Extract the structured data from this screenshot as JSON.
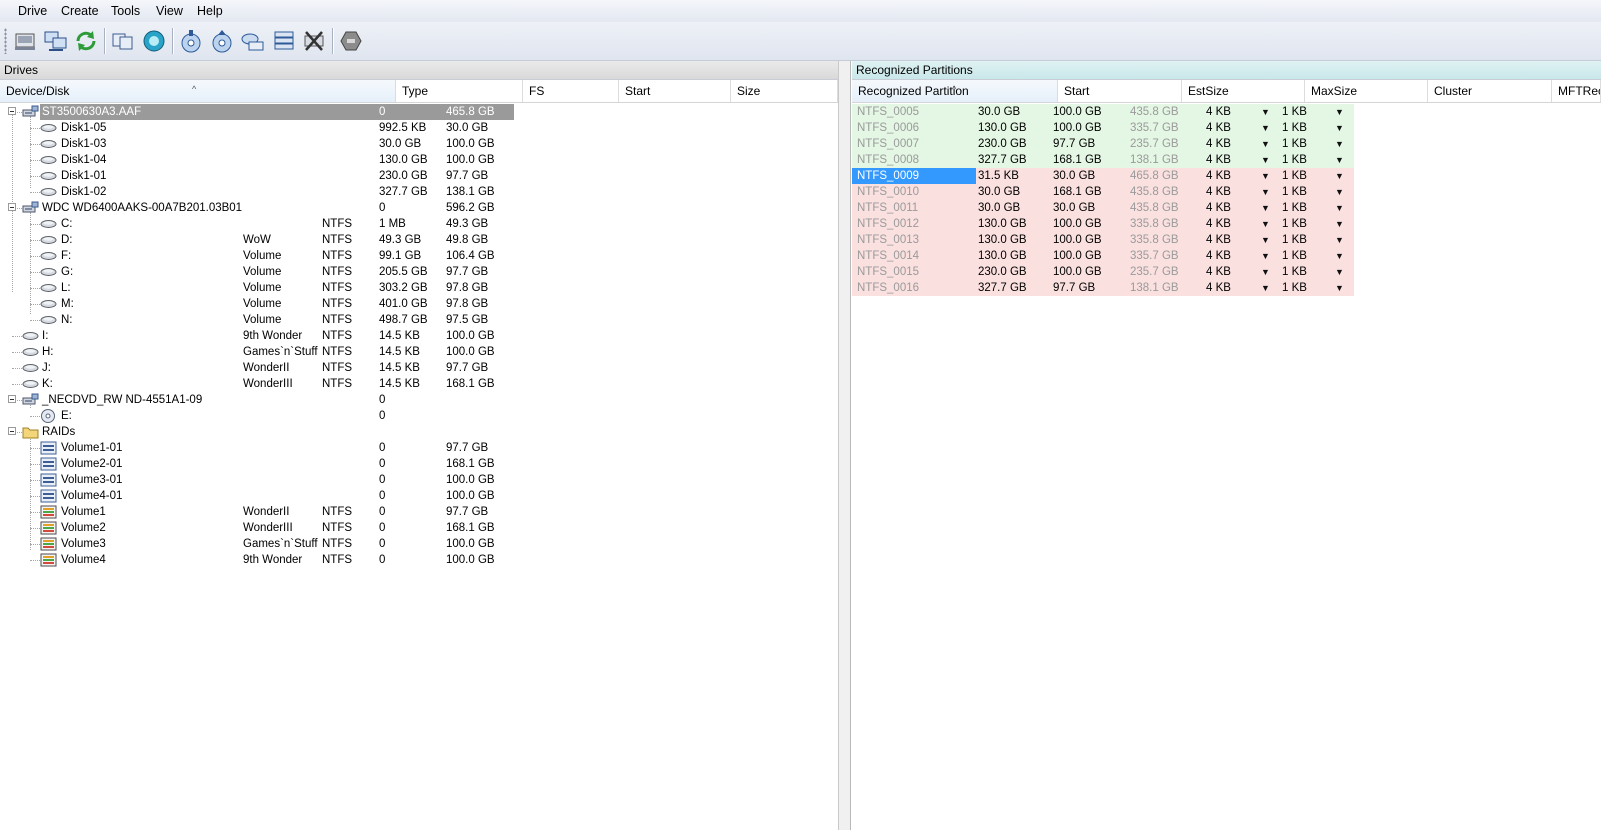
{
  "menu": [
    "Drive",
    "Create",
    "Tools",
    "View",
    "Help"
  ],
  "toolbar_icons": [
    "drive-icon",
    "network-drive-icon",
    "refresh-icon",
    "copy-icon",
    "scan-icon",
    "disk-image-icon",
    "open-image-icon",
    "virtual-drive-icon",
    "raid-icon",
    "remove-icon",
    "hex-editor-icon"
  ],
  "drives": {
    "title": "Drives",
    "columns": [
      "Device/Disk",
      "Type",
      "FS",
      "Start",
      "Size"
    ],
    "rows": [
      {
        "name": "ST3500630A3.AAF",
        "type": "",
        "fs": "",
        "start": "0",
        "size": "465.8 GB",
        "level": 0,
        "icon": "hard-disk-icon",
        "expander": true,
        "selected": true
      },
      {
        "name": "Disk1-05",
        "type": "",
        "fs": "",
        "start": "992.5 KB",
        "size": "30.0 GB",
        "level": 1,
        "icon": "partition-icon"
      },
      {
        "name": "Disk1-03",
        "type": "",
        "fs": "",
        "start": "30.0 GB",
        "size": "100.0 GB",
        "level": 1,
        "icon": "partition-icon"
      },
      {
        "name": "Disk1-04",
        "type": "",
        "fs": "",
        "start": "130.0 GB",
        "size": "100.0 GB",
        "level": 1,
        "icon": "partition-icon"
      },
      {
        "name": "Disk1-01",
        "type": "",
        "fs": "",
        "start": "230.0 GB",
        "size": "97.7 GB",
        "level": 1,
        "icon": "partition-icon"
      },
      {
        "name": "Disk1-02",
        "type": "",
        "fs": "",
        "start": "327.7 GB",
        "size": "138.1 GB",
        "level": 1,
        "icon": "partition-icon"
      },
      {
        "name": "WDC WD6400AAKS-00A7B201.03B01",
        "type": "",
        "fs": "",
        "start": "0",
        "size": "596.2 GB",
        "level": 0,
        "icon": "hard-disk-icon",
        "expander": true
      },
      {
        "name": "C:",
        "type": "",
        "fs": "NTFS",
        "start": "1 MB",
        "size": "49.3 GB",
        "level": 1,
        "icon": "partition-icon"
      },
      {
        "name": "D:",
        "type": "WoW",
        "fs": "NTFS",
        "start": "49.3 GB",
        "size": "49.8 GB",
        "level": 1,
        "icon": "partition-icon"
      },
      {
        "name": "F:",
        "type": "Volume",
        "fs": "NTFS",
        "start": "99.1 GB",
        "size": "106.4 GB",
        "level": 1,
        "icon": "partition-icon"
      },
      {
        "name": "G:",
        "type": "Volume",
        "fs": "NTFS",
        "start": "205.5 GB",
        "size": "97.7 GB",
        "level": 1,
        "icon": "partition-icon"
      },
      {
        "name": "L:",
        "type": "Volume",
        "fs": "NTFS",
        "start": "303.2 GB",
        "size": "97.8 GB",
        "level": 1,
        "icon": "partition-icon"
      },
      {
        "name": "M:",
        "type": "Volume",
        "fs": "NTFS",
        "start": "401.0 GB",
        "size": "97.8 GB",
        "level": 1,
        "icon": "partition-icon"
      },
      {
        "name": "N:",
        "type": "Volume",
        "fs": "NTFS",
        "start": "498.7 GB",
        "size": "97.5 GB",
        "level": 1,
        "icon": "partition-icon"
      },
      {
        "name": "I:",
        "type": "9th Wonder",
        "fs": "NTFS",
        "start": "14.5 KB",
        "size": "100.0 GB",
        "level": 0,
        "icon": "partition-icon"
      },
      {
        "name": "H:",
        "type": "Games`n`Stuff",
        "fs": "NTFS",
        "start": "14.5 KB",
        "size": "100.0 GB",
        "level": 0,
        "icon": "partition-icon"
      },
      {
        "name": "J:",
        "type": "WonderII",
        "fs": "NTFS",
        "start": "14.5 KB",
        "size": "97.7 GB",
        "level": 0,
        "icon": "partition-icon"
      },
      {
        "name": "K:",
        "type": "WonderIII",
        "fs": "NTFS",
        "start": "14.5 KB",
        "size": "168.1 GB",
        "level": 0,
        "icon": "partition-icon"
      },
      {
        "name": "_NECDVD_RW ND-4551A1-09",
        "type": "",
        "fs": "",
        "start": "0",
        "size": "",
        "level": 0,
        "icon": "hard-disk-icon",
        "expander": true
      },
      {
        "name": "E:",
        "type": "",
        "fs": "",
        "start": "0",
        "size": "",
        "level": 1,
        "icon": "cd-drive-icon"
      },
      {
        "name": "RAIDs",
        "type": "",
        "fs": "",
        "start": "",
        "size": "",
        "level": 0,
        "icon": "folder-icon",
        "expander": true
      },
      {
        "name": "Volume1-01",
        "type": "",
        "fs": "",
        "start": "0",
        "size": "97.7 GB",
        "level": 1,
        "icon": "raid-volume-icon"
      },
      {
        "name": "Volume2-01",
        "type": "",
        "fs": "",
        "start": "0",
        "size": "168.1 GB",
        "level": 1,
        "icon": "raid-volume-icon"
      },
      {
        "name": "Volume3-01",
        "type": "",
        "fs": "",
        "start": "0",
        "size": "100.0 GB",
        "level": 1,
        "icon": "raid-volume-icon"
      },
      {
        "name": "Volume4-01",
        "type": "",
        "fs": "",
        "start": "0",
        "size": "100.0 GB",
        "level": 1,
        "icon": "raid-volume-icon"
      },
      {
        "name": "Volume1",
        "type": "WonderII",
        "fs": "NTFS",
        "start": "0",
        "size": "97.7 GB",
        "level": 1,
        "icon": "raid-array-icon"
      },
      {
        "name": "Volume2",
        "type": "WonderIII",
        "fs": "NTFS",
        "start": "0",
        "size": "168.1 GB",
        "level": 1,
        "icon": "raid-array-icon"
      },
      {
        "name": "Volume3",
        "type": "Games`n`Stuff",
        "fs": "NTFS",
        "start": "0",
        "size": "100.0 GB",
        "level": 1,
        "icon": "raid-array-icon"
      },
      {
        "name": "Volume4",
        "type": "9th Wonder",
        "fs": "NTFS",
        "start": "0",
        "size": "100.0 GB",
        "level": 1,
        "icon": "raid-array-icon"
      }
    ]
  },
  "partitions": {
    "title": "Recognized Partitions",
    "columns": [
      "Recognized Partition",
      "Start",
      "EstSize",
      "MaxSize",
      "Cluster",
      "MFTRec"
    ],
    "rows": [
      {
        "name": "NTFS_0005",
        "start": "30.0 GB",
        "est": "100.0 GB",
        "max": "435.8 GB",
        "cluster": "4 KB",
        "mft": "1 KB",
        "status": "good"
      },
      {
        "name": "NTFS_0006",
        "start": "130.0 GB",
        "est": "100.0 GB",
        "max": "335.7 GB",
        "cluster": "4 KB",
        "mft": "1 KB",
        "status": "good"
      },
      {
        "name": "NTFS_0007",
        "start": "230.0 GB",
        "est": "97.7 GB",
        "max": "235.7 GB",
        "cluster": "4 KB",
        "mft": "1 KB",
        "status": "good"
      },
      {
        "name": "NTFS_0008",
        "start": "327.7 GB",
        "est": "168.1 GB",
        "max": "138.1 GB",
        "cluster": "4 KB",
        "mft": "1 KB",
        "status": "good"
      },
      {
        "name": "NTFS_0009",
        "start": "31.5 KB",
        "est": "30.0 GB",
        "max": "465.8 GB",
        "cluster": "4 KB",
        "mft": "1 KB",
        "status": "bad",
        "active": true
      },
      {
        "name": "NTFS_0010",
        "start": "30.0 GB",
        "est": "168.1 GB",
        "max": "435.8 GB",
        "cluster": "4 KB",
        "mft": "1 KB",
        "status": "bad"
      },
      {
        "name": "NTFS_0011",
        "start": "30.0 GB",
        "est": "30.0 GB",
        "max": "435.8 GB",
        "cluster": "4 KB",
        "mft": "1 KB",
        "status": "bad"
      },
      {
        "name": "NTFS_0012",
        "start": "130.0 GB",
        "est": "100.0 GB",
        "max": "335.8 GB",
        "cluster": "4 KB",
        "mft": "1 KB",
        "status": "bad"
      },
      {
        "name": "NTFS_0013",
        "start": "130.0 GB",
        "est": "100.0 GB",
        "max": "335.8 GB",
        "cluster": "4 KB",
        "mft": "1 KB",
        "status": "bad"
      },
      {
        "name": "NTFS_0014",
        "start": "130.0 GB",
        "est": "100.0 GB",
        "max": "335.7 GB",
        "cluster": "4 KB",
        "mft": "1 KB",
        "status": "bad"
      },
      {
        "name": "NTFS_0015",
        "start": "230.0 GB",
        "est": "100.0 GB",
        "max": "235.7 GB",
        "cluster": "4 KB",
        "mft": "1 KB",
        "status": "bad"
      },
      {
        "name": "NTFS_0016",
        "start": "327.7 GB",
        "est": "97.7 GB",
        "max": "138.1 GB",
        "cluster": "4 KB",
        "mft": "1 KB",
        "status": "bad"
      }
    ]
  },
  "colors": {
    "good_row": "#e4f6e4",
    "bad_row": "#fbe0e0",
    "selection": "#3399ff",
    "tree_selection": "#9a9a9a"
  }
}
